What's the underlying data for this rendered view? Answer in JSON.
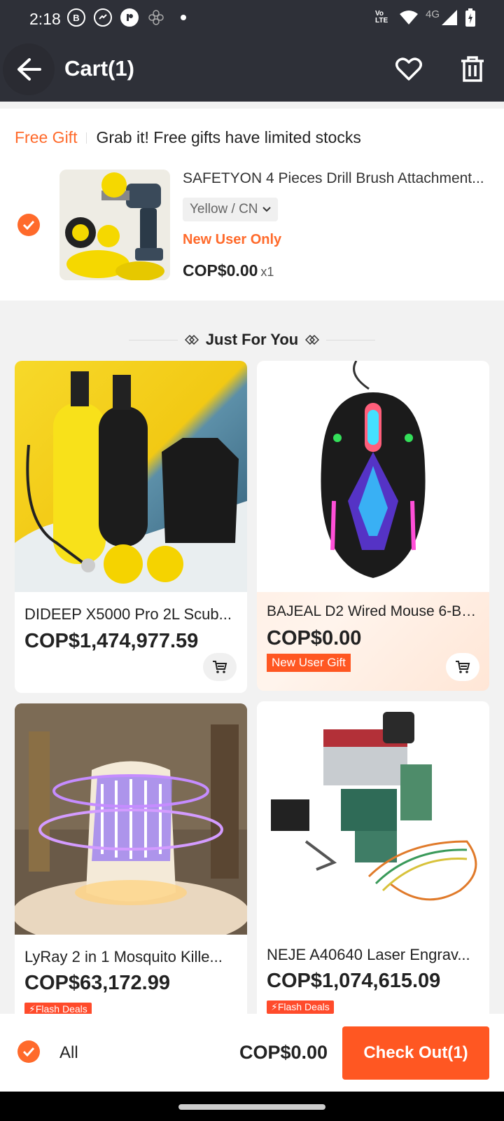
{
  "status": {
    "time": "2:18",
    "network_label": "4G",
    "lte_label": "Vo LTE",
    "app_icons": [
      "b-icon",
      "messenger-icon",
      "app-icon",
      "flower-icon"
    ]
  },
  "header": {
    "title": "Cart(1)"
  },
  "gift": {
    "tag": "Free Gift",
    "message": "Grab it! Free gifts have limited stocks",
    "product_title": "SAFETYON 4 Pieces Drill Brush Attachment...",
    "variant": "Yellow / CN",
    "new_user_label": "New User Only",
    "price": "COP$0.00",
    "qty": "x1",
    "checked": true
  },
  "recommend": {
    "heading": "Just For You",
    "items": [
      {
        "title": "DIDEEP X5000 Pro 2L Scub...",
        "price": "COP$1,474,977.59"
      },
      {
        "title": "BAJEAL D2 Wired Mouse 6-Bu...",
        "price": "COP$0.00",
        "badge": "New User Gift"
      },
      {
        "title": "LyRay 2 in 1 Mosquito Kille...",
        "price": "COP$63,172.99",
        "badge": "Flash Deals"
      },
      {
        "title": "NEJE A40640 Laser Engrav...",
        "price": "COP$1,074,615.09",
        "badge": "Flash Deals"
      }
    ]
  },
  "footer": {
    "all_label": "All",
    "total": "COP$0.00",
    "checkout_label": "Check Out(1)"
  },
  "colors": {
    "accent": "#ff6a2b",
    "header_bg": "#2e3038"
  }
}
